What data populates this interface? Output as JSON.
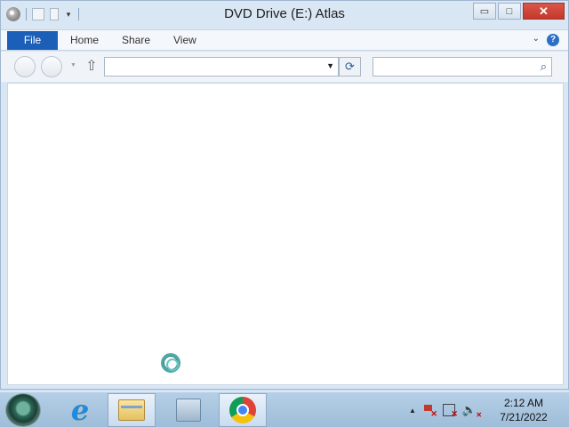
{
  "window": {
    "title": "DVD Drive (E:) Atlas",
    "controls": {
      "minimize": "▭",
      "maximize": "□",
      "close": "✕"
    }
  },
  "quick_access_toolbar": {
    "dropdown_glyph": "▾"
  },
  "ribbon": {
    "tabs": [
      {
        "label": "File",
        "active": true
      },
      {
        "label": "Home"
      },
      {
        "label": "Share"
      },
      {
        "label": "View"
      }
    ],
    "expand_glyph": "⌄",
    "help_glyph": "?"
  },
  "navigation": {
    "address_value": "",
    "search_value": "",
    "up_glyph": "⇧",
    "refresh_glyph": "⟳",
    "search_glyph": "🔍"
  },
  "taskbar": {
    "apps": [
      {
        "name": "Internet Explorer",
        "icon": "ie-icon"
      },
      {
        "name": "File Explorer",
        "icon": "folder-icon",
        "active": true
      },
      {
        "name": "Server Manager",
        "icon": "server-manager-icon"
      },
      {
        "name": "Google Chrome",
        "icon": "chrome-icon"
      }
    ],
    "clock": {
      "time": "2:12 AM",
      "date": "7/21/2022"
    }
  },
  "colors": {
    "file_tab": "#1c5fb8",
    "close_button": "#c4382b",
    "taskbar": "#a9c7e2"
  }
}
